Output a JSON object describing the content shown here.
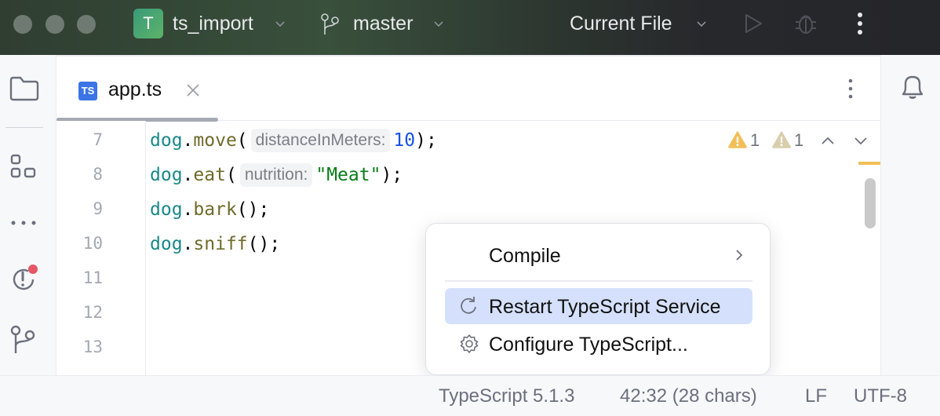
{
  "titlebar": {
    "project_badge": "T",
    "project_name": "ts_import",
    "branch": "master",
    "run_config": "Current File",
    "icons": [
      "branch-icon",
      "run-icon",
      "debug-icon",
      "more-vertical-icon"
    ]
  },
  "left_stripe": {
    "icons": [
      "folder-icon",
      "structure-icon",
      "more-horizontal-icon",
      "problems-icon",
      "git-icon"
    ]
  },
  "right_stripe": {
    "icons": [
      "notifications-icon"
    ]
  },
  "editor": {
    "tab": {
      "badge": "TS",
      "label": "app.ts"
    },
    "line_numbers": [
      "7",
      "8",
      "9",
      "10",
      "11",
      "12",
      "13"
    ],
    "lines": [
      {
        "obj": "dog",
        "dot": ".",
        "method": "move",
        "open": "(",
        "hint": "distanceInMeters:",
        "arg": "10",
        "close": ");"
      },
      {
        "obj": "dog",
        "dot": ".",
        "method": "eat",
        "open": "(",
        "hint": "nutrition:",
        "arg": "\"Meat\"",
        "close": ");"
      },
      {
        "obj": "dog",
        "dot": ".",
        "method": "bark",
        "open": "();",
        "close": ""
      },
      {
        "obj": "dog",
        "dot": ".",
        "method": "sniff",
        "open": "();",
        "close": ""
      }
    ],
    "inspections": {
      "warnings": "1",
      "weak_warnings": "1"
    },
    "colors": {
      "warning": "#f2bf57",
      "weak_warning": "#d9ceab",
      "identifier": "#1a8888",
      "method": "#6e6b2a",
      "number": "#1750eb",
      "string": "#067d17"
    }
  },
  "popup_menu": {
    "items": [
      {
        "label": "Compile",
        "icon": "",
        "has_submenu": true,
        "selected": false
      },
      {
        "label": "Restart TypeScript Service",
        "icon": "refresh-icon",
        "has_submenu": false,
        "selected": true
      },
      {
        "label": "Configure TypeScript...",
        "icon": "gear-icon",
        "has_submenu": false,
        "selected": false
      }
    ],
    "selected_color": "#d5e1fc"
  },
  "statusbar": {
    "language_service": "TypeScript 5.1.3",
    "caret": "42:32 (28 chars)",
    "line_separator": "LF",
    "encoding": "UTF-8"
  }
}
